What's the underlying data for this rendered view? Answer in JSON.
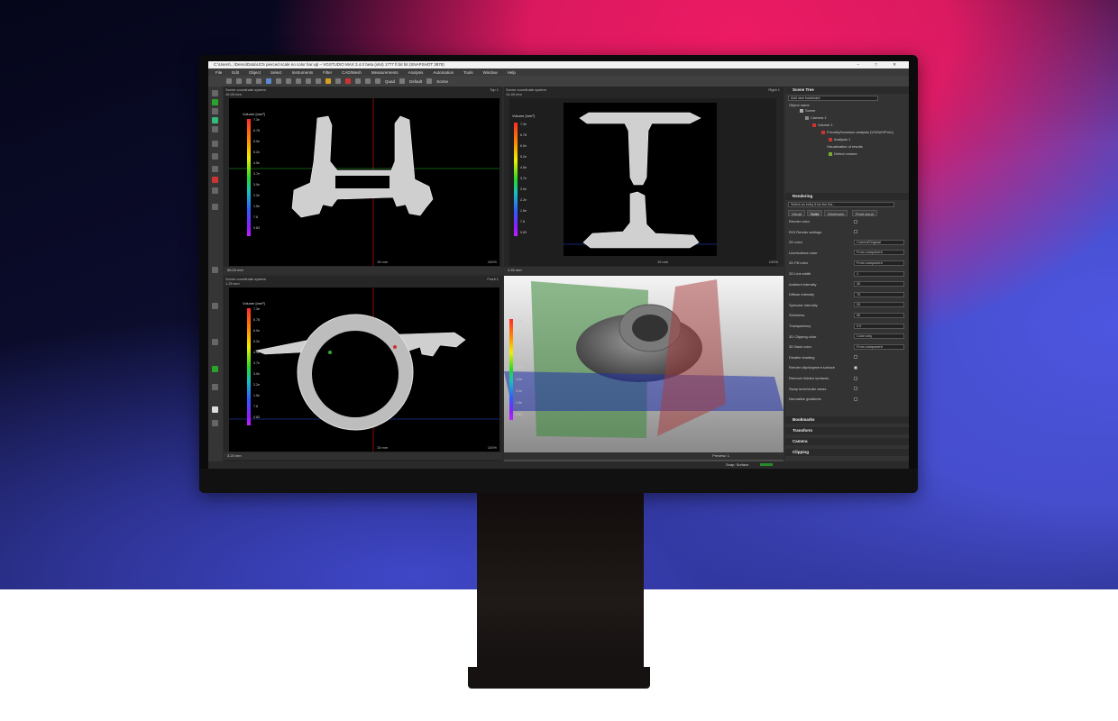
{
  "window": {
    "title": "C:\\Users\\...\\Demo\\Data\\UC5 pierced scale no color bar.vgl – VGSTUDIO MAX 3.4.0 beta (x64) 1777 ft bit bit (SNAPSHOT 3878)",
    "controls": "–  □  ✕"
  },
  "menu": [
    "File",
    "Edit",
    "Object",
    "Select",
    "Instruments",
    "Filter",
    "CAD/Mesh",
    "Measurements",
    "Analysis",
    "Automation",
    "Tools",
    "Window",
    "Help"
  ],
  "toolbar": {
    "view_mode": "Quad",
    "camera": "Default",
    "scene": "Scene"
  },
  "views": {
    "top_left": {
      "title": "Scene coordinate system",
      "subtitle": "16.45 mm",
      "name": "Top 1",
      "scale": "15 mm",
      "zoom": "56.00 mm",
      "pct": "100%"
    },
    "top_right": {
      "title": "Scene coordinate system",
      "subtitle": "14.40 mm",
      "name": "Right 1",
      "scale": "15 mm",
      "zoom": "4.45 mm",
      "pct": "100%"
    },
    "bottom_left": {
      "title": "Scene coordinate system",
      "subtitle": "1.29 mm",
      "name": "Front 1",
      "scale": "15 mm",
      "zoom": "3.23 mm",
      "pct": "100%"
    },
    "bottom_right": {
      "preview_label": "Preview:",
      "preview_value": "1"
    }
  },
  "colorbar": {
    "title": "Volume [mm³]",
    "ticks": [
      "7.3e",
      "6.78",
      "6.0e",
      "5.2e",
      "4.5e",
      "3.7e",
      "3.0e",
      "2.2e",
      "1.5e",
      "7.8",
      "0.83"
    ]
  },
  "colorbar_3d": {
    "title": "Volume [mm³]",
    "ticks": [
      "7.3e",
      "6.0e",
      "5.2e",
      "4.5e",
      "3.7e",
      "3.0e",
      "2.2e",
      "1.5e",
      "0.83"
    ]
  },
  "scene_tree": {
    "header": "Scene Tree",
    "search": "Add new bookmark",
    "column": "Object name",
    "items": [
      "Scene",
      "Camera 1",
      "Volume 1",
      "Porosity/Inclusion analysis (VGDefXPoro)",
      "Analysis 1",
      "Visualization of results",
      "Defect volume"
    ]
  },
  "rendering": {
    "header": "Rendering",
    "selector": "Select an entry from the list...",
    "tabs": [
      "Visual",
      "Solid",
      "Wireframe",
      "Point cloud"
    ],
    "rows": [
      {
        "label": "Render color",
        "kind": "check",
        "on": false
      },
      {
        "label": "ROI Render settings",
        "kind": "check",
        "on": false
      },
      {
        "label": "2D color",
        "kind": "select",
        "value": "Current/Original"
      },
      {
        "label": "Line/surface color",
        "kind": "select",
        "value": "From component"
      },
      {
        "label": "2D Fill color",
        "kind": "select",
        "value": "From component"
      },
      {
        "label": "2D Line width",
        "kind": "num",
        "value": "1"
      },
      {
        "label": "Ambient intensity",
        "kind": "num",
        "value": "30"
      },
      {
        "label": "Diffuse intensity",
        "kind": "num",
        "value": "70"
      },
      {
        "label": "Specular intensity",
        "kind": "num",
        "value": "20"
      },
      {
        "label": "Shininess",
        "kind": "num",
        "value": "50"
      },
      {
        "label": "Transparency",
        "kind": "num",
        "value": "0.0"
      },
      {
        "label": "3D Clipping color",
        "kind": "select",
        "value": "Color only"
      },
      {
        "label": "3D Back color",
        "kind": "select",
        "value": "From component"
      },
      {
        "label": "Disable shading",
        "kind": "check",
        "on": false
      },
      {
        "label": "Render clip/segment surface",
        "kind": "check",
        "on": true
      },
      {
        "label": "Remove hidden surfaces",
        "kind": "check",
        "on": false
      },
      {
        "label": "Swap inner/outer areas",
        "kind": "check",
        "on": false
      },
      {
        "label": "Normalize gradients",
        "kind": "check",
        "on": false
      }
    ]
  },
  "sections": [
    "Bookmarks",
    "Transform",
    "Camera",
    "Clipping"
  ],
  "statusbar": {
    "text": "Snap: Surface"
  },
  "colors": {
    "accent": "#ec1a63",
    "blue": "#4d56e0",
    "clip_red": "#a11",
    "clip_green": "#1a7a1a",
    "clip_blue": "#2233aa"
  }
}
